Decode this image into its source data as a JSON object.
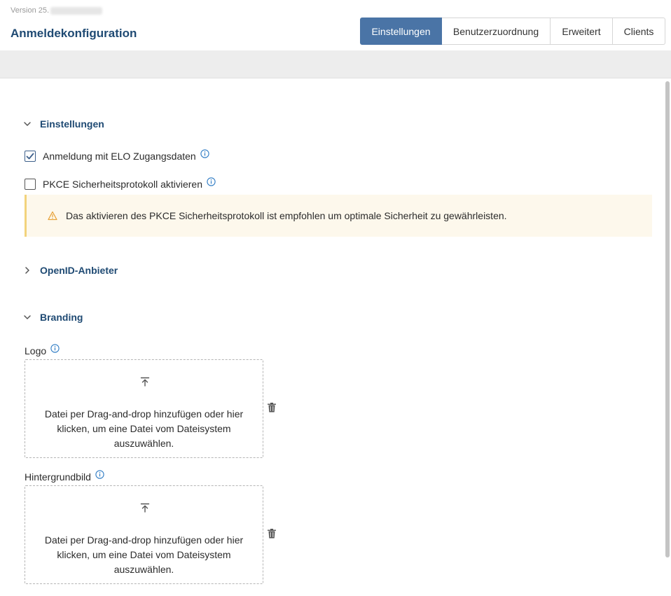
{
  "header": {
    "version_label": "Version 25.",
    "title": "Anmeldekonfiguration",
    "tabs": [
      {
        "label": "Einstellungen",
        "active": true
      },
      {
        "label": "Benutzerzuordnung",
        "active": false
      },
      {
        "label": "Erweitert",
        "active": false
      },
      {
        "label": "Clients",
        "active": false
      }
    ]
  },
  "sections": {
    "einstellungen": {
      "title": "Einstellungen",
      "expanded": true,
      "elo_login": {
        "label": "Anmeldung mit ELO Zugangsdaten",
        "checked": true
      },
      "pkce": {
        "label": "PKCE Sicherheitsprotokoll aktivieren",
        "checked": false
      },
      "warning": "Das aktivieren des PKCE Sicherheitsprotokoll ist empfohlen um optimale Sicherheit zu gewährleisten."
    },
    "openid": {
      "title": "OpenID-Anbieter",
      "expanded": false
    },
    "branding": {
      "title": "Branding",
      "expanded": true,
      "logo": {
        "label": "Logo",
        "dropzone_text": "Datei per Drag-and-drop hinzufügen oder hier klicken, um eine Datei vom Dateisystem auszuwählen."
      },
      "background": {
        "label": "Hintergrundbild",
        "dropzone_text": "Datei per Drag-and-drop hinzufügen oder hier klicken, um eine Datei vom Dateisystem auszuwählen."
      }
    }
  },
  "colors": {
    "accent": "#4a74a6",
    "title": "#1f4a73",
    "info": "#2e7bc4",
    "warning_border": "#f2d37c",
    "warning_bg": "#fdf8ec",
    "warning_icon": "#e8a33a"
  },
  "icons": {
    "chevron_down": "chevron-down-icon",
    "chevron_right": "chevron-right-icon",
    "info": "info-icon",
    "warning": "warning-icon",
    "upload": "upload-icon",
    "trash": "trash-icon",
    "check": "check-icon"
  }
}
